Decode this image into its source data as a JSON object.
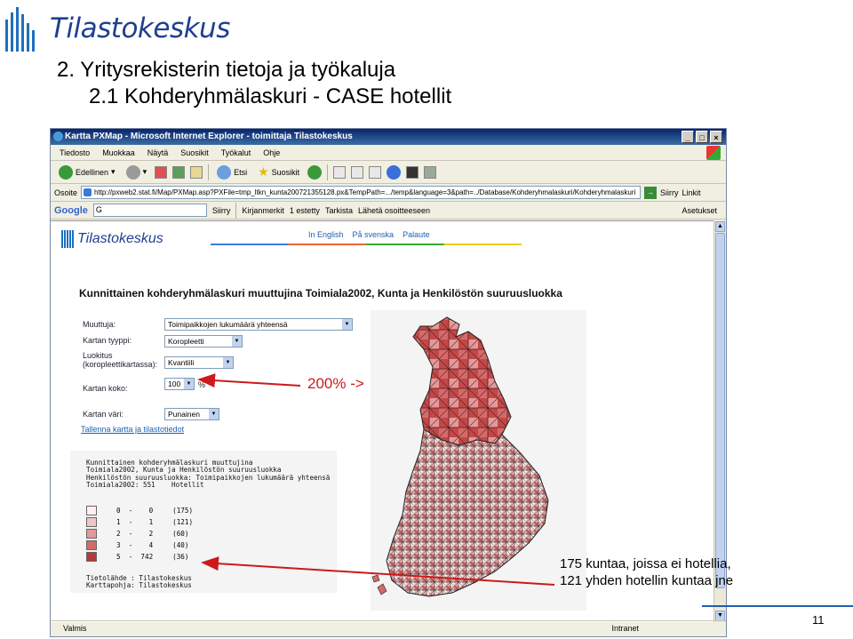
{
  "slide": {
    "brand": "Tilastokeskus",
    "title": "2. Yritysrekisterin tietoja ja työkaluja",
    "subtitle": "2.1 Kohderyhmälaskuri - CASE hotellit",
    "page_number": "11"
  },
  "browser": {
    "title": "Kartta PXMap - Microsoft Internet Explorer - toimittaja Tilastokeskus",
    "menu": [
      "Tiedosto",
      "Muokkaa",
      "Näytä",
      "Suosikit",
      "Työkalut",
      "Ohje"
    ],
    "toolbar": {
      "back": "Edellinen",
      "search": "Etsi",
      "favorites": "Suosikit"
    },
    "address_label": "Osoite",
    "address_url": "http://pxweb2.stat.fi/Map/PXMap.asp?PXFile=tmp_ltkn_kunta200721355128.px&TempPath=.../temp&language=3&path=../Database/Kohderyhmalaskuri/Kohderyhmalaskuri",
    "go_label": "Siirry",
    "links_label": "Linkit",
    "google": {
      "logo": "Google",
      "search_placeholder": "G",
      "go_label": "Siirry",
      "bookmarks": "Kirjanmerkit",
      "blocked": "1 estetty",
      "spellcheck": "Tarkista",
      "send": "Lähetä osoitteeseen",
      "settings": "Asetukset"
    },
    "status": {
      "text": "Valmis",
      "zone": "Intranet"
    }
  },
  "page": {
    "logo": "Tilastokeskus",
    "lang_links": [
      "In English",
      "På svenska",
      "Palaute"
    ],
    "heading": "Kunnittainen kohderyhmälaskuri muuttujina Toimiala2002, Kunta ja Henkilöstön suuruusluokka",
    "form": {
      "variable_label": "Muuttuja:",
      "variable_value": "Toimipaikkojen lukumäärä yhteensä",
      "map_type_label": "Kartan tyyppi:",
      "map_type_value": "Koropleetti",
      "classes_label": "Luokitus (koropleettikartassa):",
      "classes_value": "Kvantiili",
      "size_label": "Kartan koko:",
      "size_value": "100",
      "size_unit": "%",
      "color_label": "Kartan väri:",
      "color_value": "Punainen",
      "save_link": "Tallenna kartta ja tilastotiedot"
    },
    "report_text": "Kunnittainen kohderyhmälaskuri muuttujina\nToimiala2002, Kunta ja Henkilöstön suuruusluokka\nHenkilöstön suuruusluokka: Toimipaikkojen lukumäärä yhteensä\nToimiala2002: 551    Hotellit",
    "legend": [
      {
        "range": "0  -    0",
        "count": "(175)",
        "color": "#fdf0f0"
      },
      {
        "range": "1  -    1",
        "count": "(121)",
        "color": "#f2c4c4"
      },
      {
        "range": "2  -    2",
        "count": "(60)",
        "color": "#e39a9a"
      },
      {
        "range": "3  -    4",
        "count": "(40)",
        "color": "#d46a6a"
      },
      {
        "range": "5  -  742",
        "count": "(36)",
        "color": "#b73a3a"
      }
    ],
    "source_text": "Tietolähde : Tilastokeskus\nKarttapohja: Tilastokeskus"
  },
  "annotations": {
    "zoom_note": "200% ->",
    "kunta_note_line1": "175 kuntaa, joissa ei hotellia,",
    "kunta_note_line2": "121 yhden hotellin kuntaa jne",
    "arrow_color": "#cc1a1a"
  }
}
